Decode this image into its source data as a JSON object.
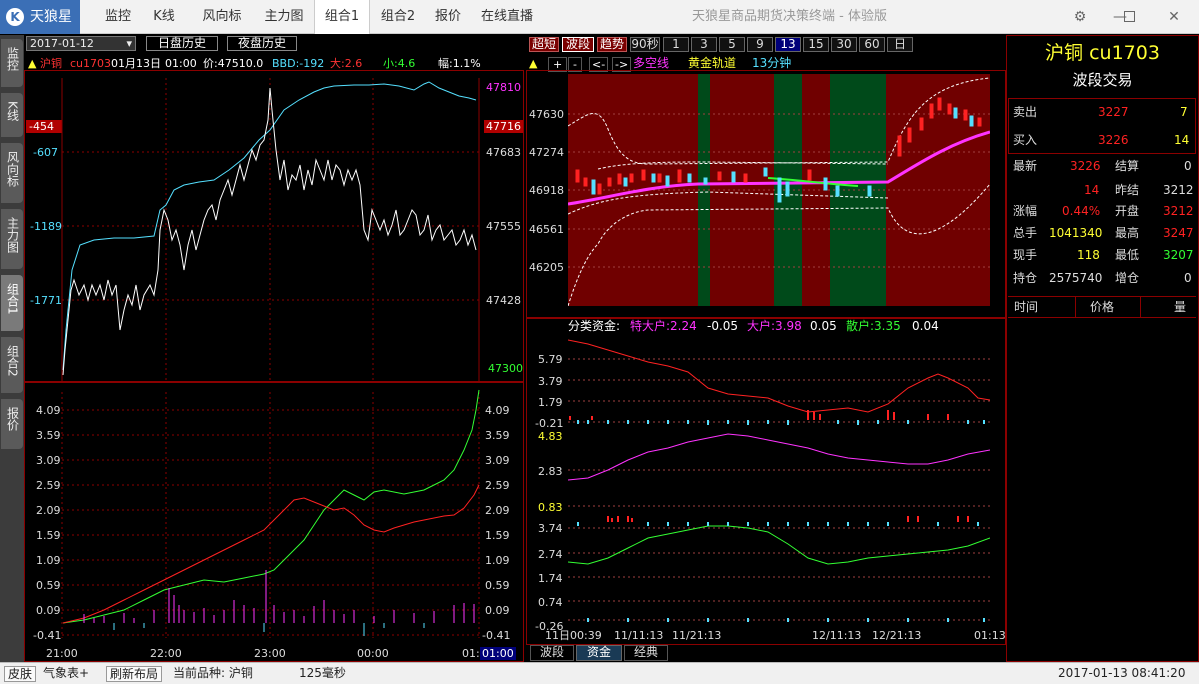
{
  "app": {
    "logo": "天狼星",
    "title": "天狼星商品期货决策终端 - 体验版",
    "tabs": [
      "监控",
      "K线",
      "风向标",
      "主力图",
      "组合1",
      "组合2",
      "报价",
      "在线直播"
    ],
    "active_tab": "组合1"
  },
  "sidebar": {
    "tabs": [
      "监控",
      "K线",
      "风向标",
      "主力图",
      "组合1",
      "组合2",
      "报价"
    ]
  },
  "left": {
    "date": "2017-01-12",
    "day_history": "日盘历史",
    "night_history": "夜盘历史",
    "info": {
      "name": "沪铜",
      "code": "cu1703",
      "date": "01月13日",
      "time": "01:00",
      "price": "价:47510.0",
      "bbd": "BBD:-192",
      "big": "大:2.6",
      "small": "小:4.6",
      "range": "幅:1.1%"
    },
    "y_left": [
      "-454",
      "-607",
      "-1189",
      "-1771"
    ],
    "y_right": [
      "47810",
      "47716",
      "47683",
      "47555",
      "47428",
      "47300"
    ],
    "ind_y": [
      "4.09",
      "3.59",
      "3.09",
      "2.59",
      "2.09",
      "1.59",
      "1.09",
      "0.59",
      "0.09",
      "-0.41"
    ],
    "x": [
      "21:00",
      "22:00",
      "23:00",
      "00:00",
      "01:00"
    ]
  },
  "right": {
    "periods": [
      "超短",
      "波段",
      "趋势",
      "90秒",
      "1",
      "3",
      "5",
      "9",
      "13",
      "15",
      "30",
      "60",
      "日"
    ],
    "tools": [
      "▲",
      "+",
      "-",
      "<-",
      "->"
    ],
    "legend": [
      "多空线",
      "黄金轨道",
      "13分钟"
    ],
    "price_y": [
      "47630",
      "47274",
      "46918",
      "46561",
      "46205"
    ],
    "fund_title": "分类资金:",
    "fund_legend": [
      "特大户:2.24",
      "-0.05",
      "大户:3.98",
      "0.05",
      "散户:3.35",
      "0.04"
    ],
    "fund_y1": [
      "5.79",
      "3.79",
      "1.79",
      "-0.21"
    ],
    "fund_y2": [
      "4.83",
      "2.83",
      "0.83"
    ],
    "fund_y3": [
      "3.74",
      "2.74",
      "1.74",
      "0.74",
      "-0.26"
    ],
    "x": [
      "11日00:39",
      "11/11:13",
      "11/21:13",
      "12/11:13",
      "12/21:13",
      "01:13"
    ],
    "bottom_tabs": [
      "波段",
      "资金",
      "经典"
    ]
  },
  "quote": {
    "title": "沪铜 cu1703",
    "subtitle": "波段交易",
    "sell": {
      "label": "卖出",
      "price": "3227",
      "vol": "7"
    },
    "buy": {
      "label": "买入",
      "price": "3226",
      "vol": "14"
    },
    "rows": [
      [
        "最新",
        "3226",
        "结算",
        "0"
      ],
      [
        "",
        "14",
        "昨结",
        "3212"
      ],
      [
        "涨幅",
        "0.44%",
        "开盘",
        "3212"
      ],
      [
        "总手",
        "1041340",
        "最高",
        "3247"
      ],
      [
        "现手",
        "118",
        "最低",
        "3207"
      ],
      [
        "持仓",
        "2575740",
        "增仓",
        "0"
      ]
    ],
    "cols": [
      "时间",
      "价格",
      "量"
    ]
  },
  "status": {
    "skin": "皮肤",
    "weather": "气象表+",
    "refresh": "刷新布局",
    "current": "当前品种: 沪铜",
    "latency": "125毫秒",
    "datetime": "2017-01-13  08:41:20"
  },
  "colors": {
    "red": "#ff2222",
    "cyan": "#55e0ff",
    "green": "#33ff33",
    "magenta": "#ff33ff",
    "yellow": "#ffff33"
  }
}
